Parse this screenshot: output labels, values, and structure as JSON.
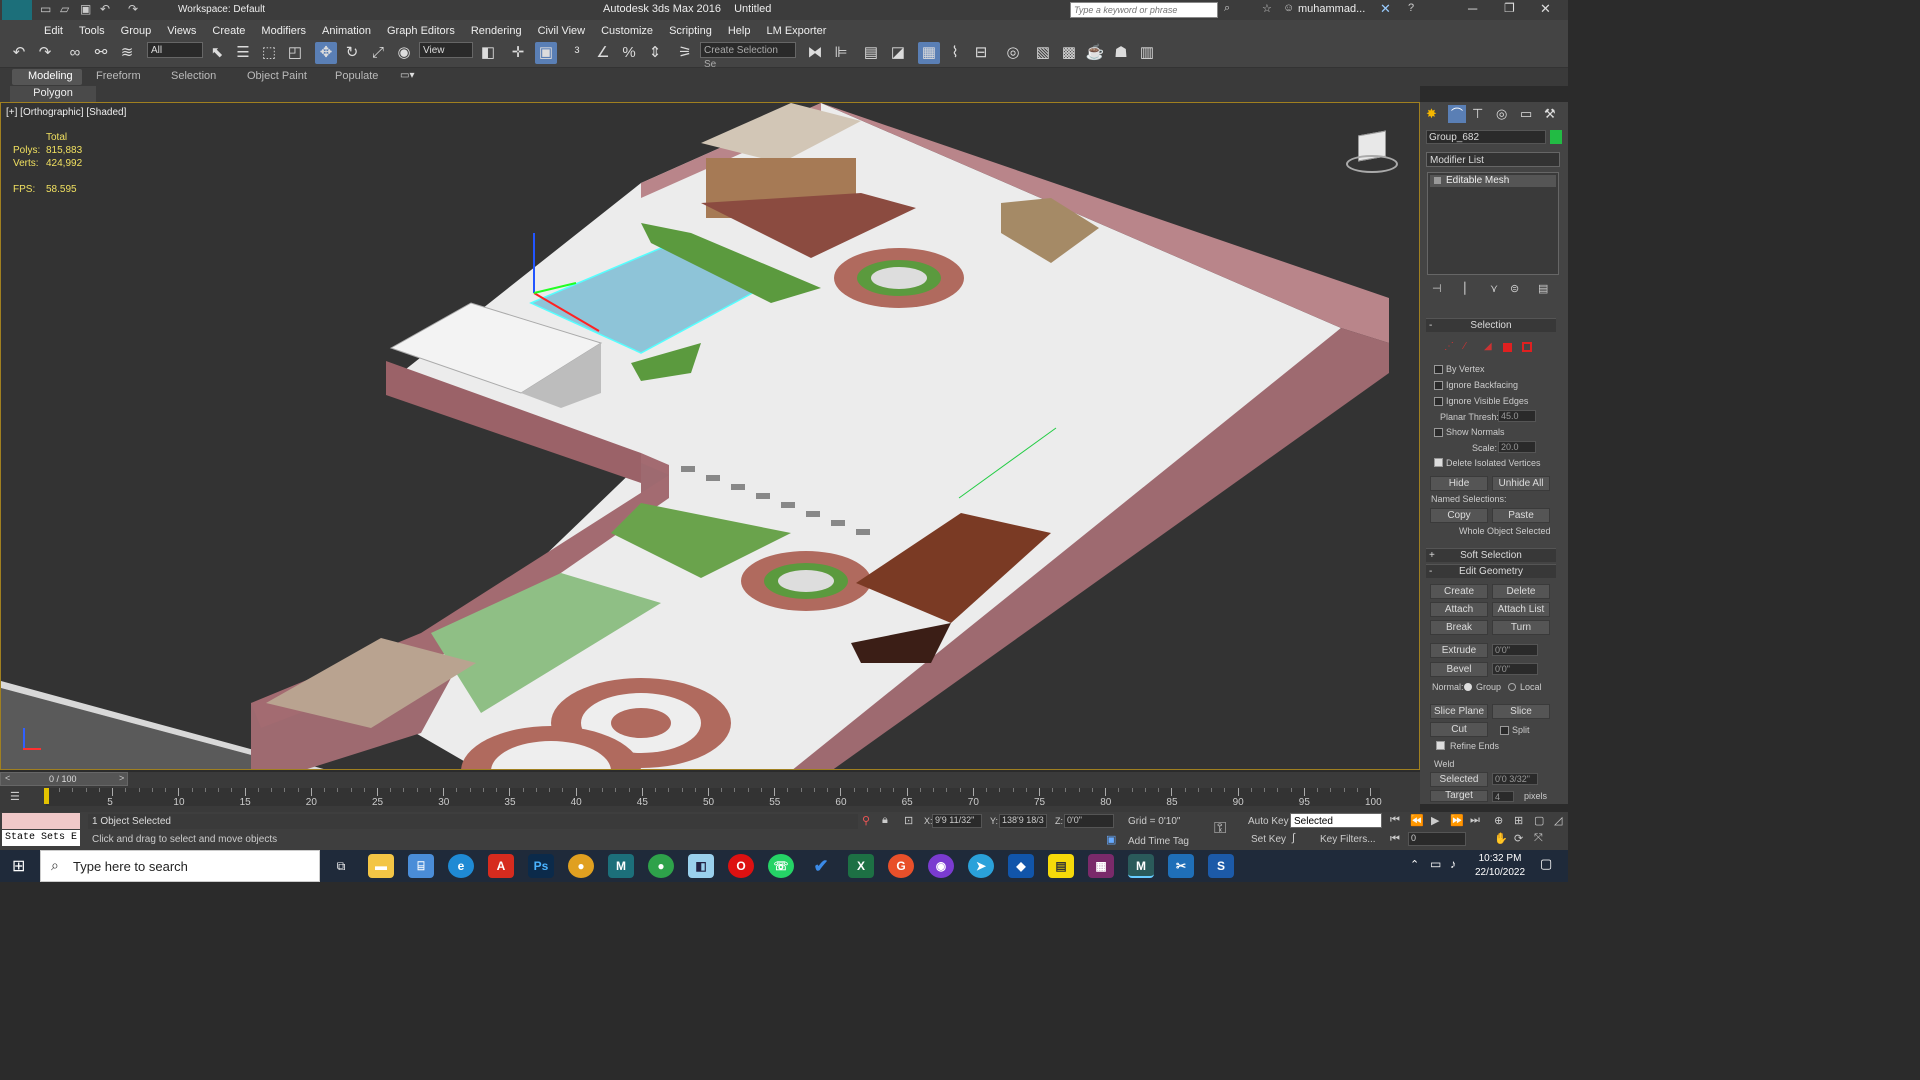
{
  "title_bar": {
    "workspace": "Workspace: Default",
    "app_title": "Autodesk 3ds Max 2016",
    "doc_title": "Untitled",
    "search_placeholder": "Type a keyword or phrase",
    "user": "muhammad..."
  },
  "menu": [
    "Edit",
    "Tools",
    "Group",
    "Views",
    "Create",
    "Modifiers",
    "Animation",
    "Graph Editors",
    "Rendering",
    "Civil View",
    "Customize",
    "Scripting",
    "Help",
    "LM Exporter"
  ],
  "toolbar": {
    "filter": "All",
    "ref_coord": "View",
    "selection_set_placeholder": "Create Selection Se"
  },
  "ribbon": {
    "tabs": [
      "Modeling",
      "Freeform",
      "Selection",
      "Object Paint",
      "Populate"
    ],
    "active_tab": "Modeling",
    "sub_label": "Polygon Modeling"
  },
  "viewport": {
    "label": "[+] [Orthographic] [Shaded]",
    "stats": {
      "total_label": "Total",
      "polys_label": "Polys:",
      "polys_value": "815,883",
      "verts_label": "Verts:",
      "verts_value": "424,992",
      "fps_label": "FPS:",
      "fps_value": "58.595"
    }
  },
  "command_panel": {
    "object_name": "Group_682",
    "modifier_list": "Modifier List",
    "stack_item": "Editable Mesh",
    "selection": {
      "title": "Selection",
      "by_vertex": "By Vertex",
      "ignore_backfacing": "Ignore Backfacing",
      "ignore_visible_edges": "Ignore Visible Edges",
      "planar_thresh_label": "Planar Thresh:",
      "planar_thresh_value": "45.0",
      "show_normals": "Show Normals",
      "scale_label": "Scale:",
      "scale_value": "20.0",
      "delete_isolated": "Delete Isolated Vertices",
      "hide": "Hide",
      "unhide_all": "Unhide All",
      "named_selections": "Named Selections:",
      "copy": "Copy",
      "paste": "Paste",
      "status": "Whole Object Selected"
    },
    "soft_selection": "Soft Selection",
    "edit_geometry": {
      "title": "Edit Geometry",
      "create": "Create",
      "delete": "Delete",
      "attach": "Attach",
      "attach_list": "Attach List",
      "break": "Break",
      "turn": "Turn",
      "extrude": "Extrude",
      "extrude_value": "0'0\"",
      "bevel": "Bevel",
      "bevel_value": "0'0\"",
      "normal_label": "Normal:",
      "group": "Group",
      "local": "Local",
      "slice_plane": "Slice Plane",
      "slice": "Slice",
      "cut": "Cut",
      "split": "Split",
      "refine_ends": "Refine Ends",
      "weld": "Weld",
      "selected": "Selected",
      "selected_value": "0'0 3/32\"",
      "target": "Target",
      "target_value": "4",
      "pixels": "pixels"
    }
  },
  "timeline": {
    "frame": "0 / 100",
    "ticks": [
      "5",
      "10",
      "15",
      "20",
      "25",
      "30",
      "35",
      "40",
      "45",
      "50",
      "55",
      "60",
      "65",
      "70",
      "75",
      "80",
      "85",
      "90",
      "95",
      "100"
    ]
  },
  "status": {
    "state_sets": "State Sets E",
    "selected": "1 Object Selected",
    "prompt": "Click and drag to select and move objects",
    "x_label": "X:",
    "x_value": "9'9 11/32\"",
    "y_label": "Y:",
    "y_value": "138'9 18/3",
    "z_label": "Z:",
    "z_value": "0'0\"",
    "grid": "Grid = 0'10\"",
    "add_time_tag": "Add Time Tag",
    "auto_key": "Auto Key",
    "auto_key_mode": "Selected",
    "set_key": "Set Key",
    "key_filters": "Key Filters...",
    "frame_value": "0"
  },
  "taskbar": {
    "search_placeholder": "Type here to search",
    "time": "10:32 PM",
    "date": "22/10/2022"
  }
}
